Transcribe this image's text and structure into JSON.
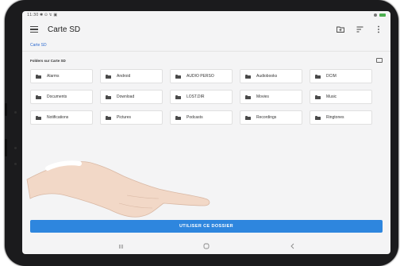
{
  "status_bar": {
    "time": "11:30 ✱ ⊙ ↯ ▣"
  },
  "app_bar": {
    "title": "Carte SD",
    "icons": [
      "menu-icon",
      "new-folder-icon",
      "sort-icon",
      "more-vert-icon"
    ]
  },
  "breadcrumb": {
    "path": "Carte SD"
  },
  "section": {
    "title": "Folders sur Carte SD"
  },
  "folders": [
    "Alarms",
    "Android",
    "AUDIO PERSO",
    "Audiobooks",
    "DCIM",
    "Documents",
    "Download",
    "LOST.DIR",
    "Movies",
    "Music",
    "Notifications",
    "Pictures",
    "Podcasts",
    "Recordings",
    "Ringtones"
  ],
  "primary_button": {
    "label": "UTILISER CE DOSSIER"
  },
  "nav_bar": {
    "icons": [
      "recents-icon",
      "home-icon",
      "back-icon"
    ]
  },
  "colors": {
    "accent": "#2e86de",
    "screen_bg": "#f4f4f5",
    "bezel": "#1b1b1d",
    "battery": "#4caf50"
  }
}
